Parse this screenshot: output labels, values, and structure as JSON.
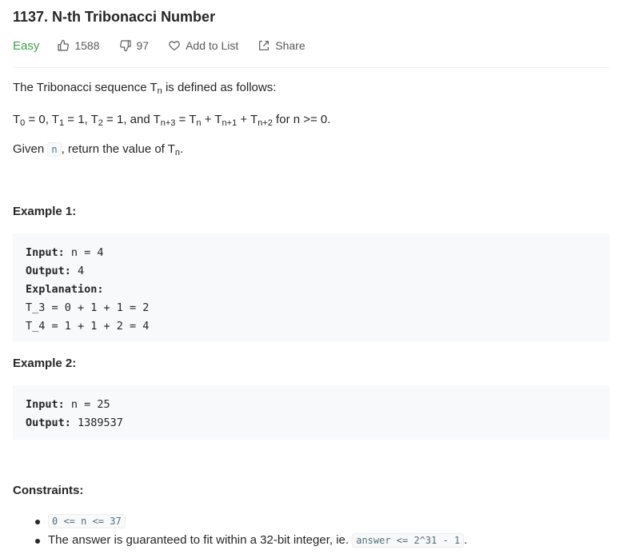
{
  "problem": {
    "title": "1137. N-th Tribonacci Number",
    "difficulty": "Easy",
    "likes": "1588",
    "dislikes": "97",
    "add_to_list": "Add to List",
    "share": "Share"
  },
  "description": {
    "intro_text": "The Tribonacci sequence T",
    "intro_sub": "n",
    "intro_rest": " is defined as follows:",
    "def_parts": [
      "T",
      "0",
      " = 0, T",
      "1",
      " = 1, T",
      "2",
      " = 1, and T",
      "n+3",
      " = T",
      "n",
      " + T",
      "n+1",
      " + T",
      "n+2",
      " for n >= 0."
    ],
    "given_prefix": "Given ",
    "given_code": "n",
    "given_mid": ", return the value of T",
    "given_sub": "n",
    "given_suffix": "."
  },
  "examples": [
    {
      "heading": "Example 1:",
      "input_label": "Input:",
      "input_value": " n = 4",
      "output_label": "Output:",
      "output_value": " 4",
      "explanation_label": "Explanation:",
      "explanation_lines": [
        "T_3 = 0 + 1 + 1 = 2",
        "T_4 = 1 + 1 + 2 = 4"
      ]
    },
    {
      "heading": "Example 2:",
      "input_label": "Input:",
      "input_value": " n = 25",
      "output_label": "Output:",
      "output_value": " 1389537"
    }
  ],
  "constraints": {
    "heading": "Constraints:",
    "item1_code": "0 <= n <= 37",
    "item2_text": "The answer is guaranteed to fit within a 32-bit integer, ie. ",
    "item2_code": "answer <= 2^31 - 1",
    "item2_suffix": "."
  },
  "icons": {
    "like": "thumbs-up-icon",
    "dislike": "thumbs-down-icon",
    "add": "heart-icon",
    "share": "share-icon"
  },
  "colors": {
    "easy": "#43a047",
    "code_bg": "#f7f9fa",
    "text": "#262626"
  }
}
